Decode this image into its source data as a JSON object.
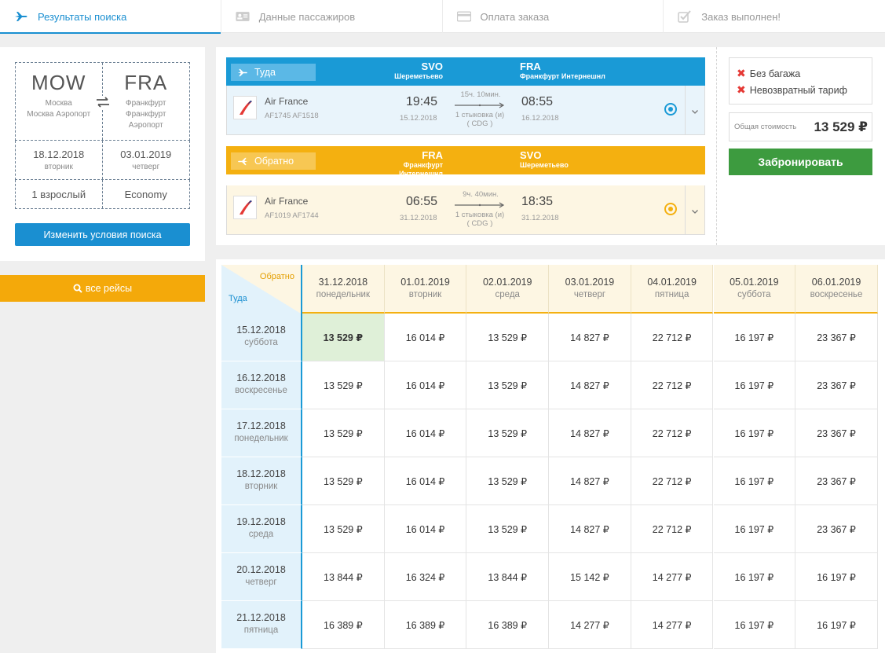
{
  "steps": [
    {
      "label": "Результаты поиска",
      "icon": "plane-icon"
    },
    {
      "label": "Данные пассажиров",
      "icon": "id-card-icon"
    },
    {
      "label": "Оплата заказа",
      "icon": "credit-card-icon"
    },
    {
      "label": "Заказ выполнен!",
      "icon": "checkbox-icon"
    }
  ],
  "search": {
    "from_code": "MOW",
    "from_city": "Москва",
    "from_airport": "Москва Аэропорт",
    "to_code": "FRA",
    "to_city": "Франкфурт",
    "to_airport_1": "Франкфурт",
    "to_airport_2": "Аэропорт",
    "depart_date": "18.12.2018",
    "depart_weekday": "вторник",
    "return_date": "03.01.2019",
    "return_weekday": "четверг",
    "passengers": "1 взрослый",
    "cabin": "Economy",
    "change_button": "Изменить условия поиска",
    "all_flights_button": "все рейсы"
  },
  "outbound": {
    "tag": "Туда",
    "dep_code": "SVO",
    "dep_name": "Шереметьево",
    "arr_code": "FRA",
    "arr_name": "Франкфурт Интернешнл",
    "airline": "Air France",
    "flights": "AF1745 AF1518",
    "dep_time": "19:45",
    "dep_date": "15.12.2018",
    "duration": "15ч. 10мин.",
    "stops": "1 стыковка (и)",
    "via": "( CDG )",
    "arr_time": "08:55",
    "arr_date": "16.12.2018"
  },
  "return": {
    "tag": "Обратно",
    "dep_code": "FRA",
    "dep_name_1": "Франкфурт",
    "dep_name_2": "Интернешнл",
    "arr_code": "SVO",
    "arr_name": "Шереметьево",
    "airline": "Air France",
    "flights": "AF1019 AF1744",
    "dep_time": "06:55",
    "dep_date": "31.12.2018",
    "duration": "9ч. 40мин.",
    "stops": "1 стыковка (и)",
    "via": "( CDG )",
    "arr_time": "18:35",
    "arr_date": "31.12.2018"
  },
  "tariff": {
    "no_baggage": "Без багажа",
    "non_refundable": "Невозвратный тариф",
    "total_label": "Общая стоимость",
    "total_value": "13 529 ₽",
    "book_button": "Забронировать"
  },
  "matrix": {
    "corner_return": "Обратно",
    "corner_outbound": "Туда",
    "columns": [
      {
        "date": "31.12.2018",
        "day": "понедельник"
      },
      {
        "date": "01.01.2019",
        "day": "вторник"
      },
      {
        "date": "02.01.2019",
        "day": "среда"
      },
      {
        "date": "03.01.2019",
        "day": "четверг"
      },
      {
        "date": "04.01.2019",
        "day": "пятница"
      },
      {
        "date": "05.01.2019",
        "day": "суббота"
      },
      {
        "date": "06.01.2019",
        "day": "воскресенье"
      }
    ],
    "rows": [
      {
        "date": "15.12.2018",
        "day": "суббота",
        "prices": [
          "13 529 ₽",
          "16 014 ₽",
          "13 529 ₽",
          "14 827 ₽",
          "22 712 ₽",
          "16 197 ₽",
          "23 367 ₽"
        ]
      },
      {
        "date": "16.12.2018",
        "day": "воскресенье",
        "prices": [
          "13 529 ₽",
          "16 014 ₽",
          "13 529 ₽",
          "14 827 ₽",
          "22 712 ₽",
          "16 197 ₽",
          "23 367 ₽"
        ]
      },
      {
        "date": "17.12.2018",
        "day": "понедельник",
        "prices": [
          "13 529 ₽",
          "16 014 ₽",
          "13 529 ₽",
          "14 827 ₽",
          "22 712 ₽",
          "16 197 ₽",
          "23 367 ₽"
        ]
      },
      {
        "date": "18.12.2018",
        "day": "вторник",
        "prices": [
          "13 529 ₽",
          "16 014 ₽",
          "13 529 ₽",
          "14 827 ₽",
          "22 712 ₽",
          "16 197 ₽",
          "23 367 ₽"
        ]
      },
      {
        "date": "19.12.2018",
        "day": "среда",
        "prices": [
          "13 529 ₽",
          "16 014 ₽",
          "13 529 ₽",
          "14 827 ₽",
          "22 712 ₽",
          "16 197 ₽",
          "23 367 ₽"
        ]
      },
      {
        "date": "20.12.2018",
        "day": "четверг",
        "prices": [
          "13 844 ₽",
          "16 324 ₽",
          "13 844 ₽",
          "15 142 ₽",
          "14 277 ₽",
          "16 197 ₽",
          "16 197 ₽"
        ]
      },
      {
        "date": "21.12.2018",
        "day": "пятница",
        "prices": [
          "16 389 ₽",
          "16 389 ₽",
          "16 389 ₽",
          "14 277 ₽",
          "14 277 ₽",
          "16 197 ₽",
          "16 197 ₽"
        ]
      }
    ]
  }
}
